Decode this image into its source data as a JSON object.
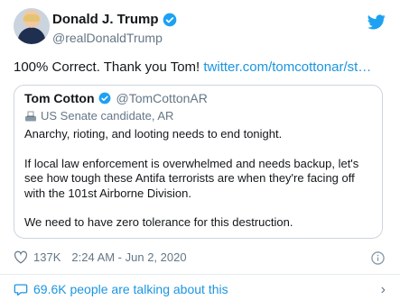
{
  "author": {
    "name": "Donald J. Trump",
    "handle": "@realDonaldTrump"
  },
  "tweet": {
    "text": "100% Correct. Thank you Tom! ",
    "link": "twitter.com/tomcottonar/st…"
  },
  "quoted": {
    "name": "Tom Cotton",
    "handle": "@TomCottonAR",
    "label": "US Senate candidate, AR",
    "paragraphs": [
      "Anarchy, rioting, and looting needs to end tonight.",
      "If local law enforcement is overwhelmed and needs backup, let's see how tough these Antifa terrorists are when they're facing off with the 101st Airborne Division.",
      "We need to have zero tolerance for this destruction."
    ]
  },
  "meta": {
    "likes": "137K",
    "timestamp": "2:24 AM - Jun 2, 2020"
  },
  "talking": "69.6K people are talking about this",
  "colors": {
    "accent": "#1b95e0",
    "verified": "#1da1f2",
    "muted": "#657786",
    "border": "#ccd6dd"
  },
  "icons": [
    "verified-badge-icon",
    "twitter-bird-icon",
    "ballot-box-icon",
    "heart-icon",
    "info-icon",
    "comment-icon",
    "chevron-right-icon"
  ]
}
